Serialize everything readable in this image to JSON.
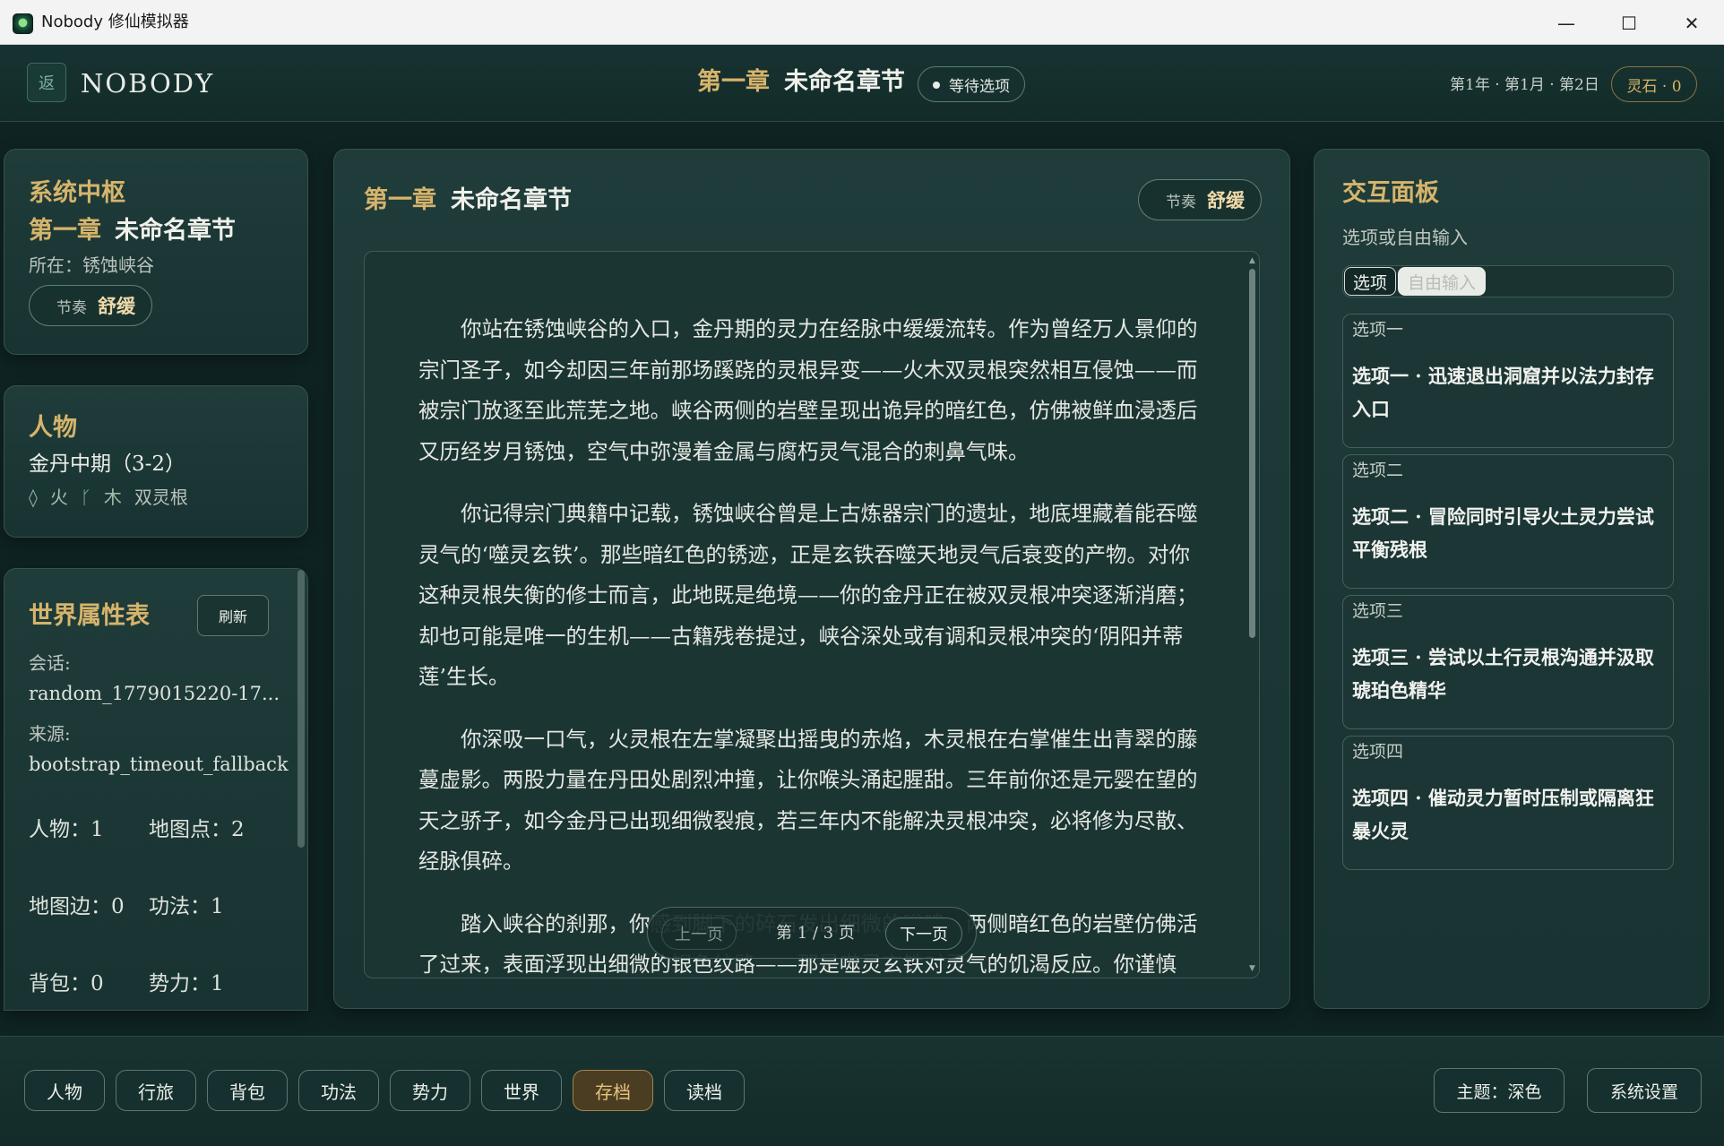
{
  "window": {
    "title": "Nobody 修仙模拟器",
    "minimize_glyph": "—",
    "maximize_glyph": "☐",
    "close_glyph": "✕"
  },
  "header": {
    "back_label": "返",
    "brand": "NOBODY",
    "chapter_number": "第一章",
    "chapter_name": "未命名章节",
    "status": "等待选项",
    "date": "第1年 · 第1月 · 第2日",
    "spirit_stones": "灵石 · 0"
  },
  "system": {
    "title": "系统中枢",
    "chapter_number": "第一章",
    "chapter_name": "未命名章节",
    "location": "所在：锈蚀峡谷",
    "rhythm_label": "节奏",
    "rhythm_value": "舒缓"
  },
  "character": {
    "title": "人物",
    "realm": "金丹中期（3-2）",
    "fire_icon": "◊",
    "fire_label": "火",
    "wood_icon": "ᚴ",
    "wood_label": "木",
    "root_type": "双灵根"
  },
  "world": {
    "title": "世界属性表",
    "refresh_label": "刷新",
    "session_label": "会话:",
    "session_value": "random_1779015220-17...",
    "source_label": "来源:",
    "source_value": "bootstrap_timeout_fallback",
    "stats": {
      "characters": "人物：1",
      "map_points": "地图点：2",
      "map_edges": "地图边：0",
      "techniques": "功法：1",
      "inventory": "背包：0",
      "factions": "势力：1"
    }
  },
  "story": {
    "chapter_number": "第一章",
    "chapter_name": "未命名章节",
    "rhythm_label": "节奏",
    "rhythm_value": "舒缓",
    "paragraphs": [
      "你站在锈蚀峡谷的入口，金丹期的灵力在经脉中缓缓流转。作为曾经万人景仰的宗门圣子，如今却因三年前那场蹊跷的灵根异变——火木双灵根突然相互侵蚀——而被宗门放逐至此荒芜之地。峡谷两侧的岩壁呈现出诡异的暗红色，仿佛被鲜血浸透后又历经岁月锈蚀，空气中弥漫着金属与腐朽灵气混合的刺鼻气味。",
      "你记得宗门典籍中记载，锈蚀峡谷曾是上古炼器宗门的遗址，地底埋藏着能吞噬灵气的‘噬灵玄铁’。那些暗红色的锈迹，正是玄铁吞噬天地灵气后衰变的产物。对你这种灵根失衡的修士而言，此地既是绝境——你的金丹正在被双灵根冲突逐渐消磨；却也可能是唯一的生机——古籍残卷提过，峡谷深处或有调和灵根冲突的‘阴阳并蒂莲’生长。",
      "你深吸一口气，火灵根在左掌凝聚出摇曳的赤焰，木灵根在右掌催生出青翠的藤蔓虚影。两股力量在丹田处剧烈冲撞，让你喉头涌起腥甜。三年前你还是元婴在望的天之骄子，如今金丹已出现细微裂痕，若三年内不能解决灵根冲突，必将修为尽散、经脉俱碎。",
      "踏入峡谷的刹那，你感到脚下的碎石发出细微的嗡鸣，两侧暗红色的岩壁仿佛活了过来，表面浮现出细微的银色纹路——那是噬灵玄铁对灵气的饥渴反应。你谨慎"
    ],
    "pager": {
      "prev": "上一页",
      "indicator": "第 1 / 3 页",
      "next": "下一页"
    }
  },
  "interaction": {
    "title": "交互面板",
    "subtitle": "选项或自由输入",
    "tab_options": "选项",
    "tab_free": "自由输入",
    "options": [
      {
        "header": "选项一",
        "text": "选项一 · 迅速退出洞窟并以法力封存入口"
      },
      {
        "header": "选项二",
        "text": "选项二 · 冒险同时引导火土灵力尝试平衡残根"
      },
      {
        "header": "选项三",
        "text": "选项三 · 尝试以土行灵根沟通并汲取琥珀色精华"
      },
      {
        "header": "选项四",
        "text": "选项四 · 催动灵力暂时压制或隔离狂暴火灵"
      }
    ]
  },
  "bottom": {
    "nav": [
      "人物",
      "行旅",
      "背包",
      "功法",
      "势力",
      "世界",
      "存档",
      "读档"
    ],
    "active_nav": "存档",
    "theme": "主题：深色",
    "settings": "系统设置"
  },
  "colors": {
    "background": "#0e2322",
    "panel": "#1f3c3a",
    "accent_gold": "#d6b46b",
    "text": "#dfe3dc"
  }
}
